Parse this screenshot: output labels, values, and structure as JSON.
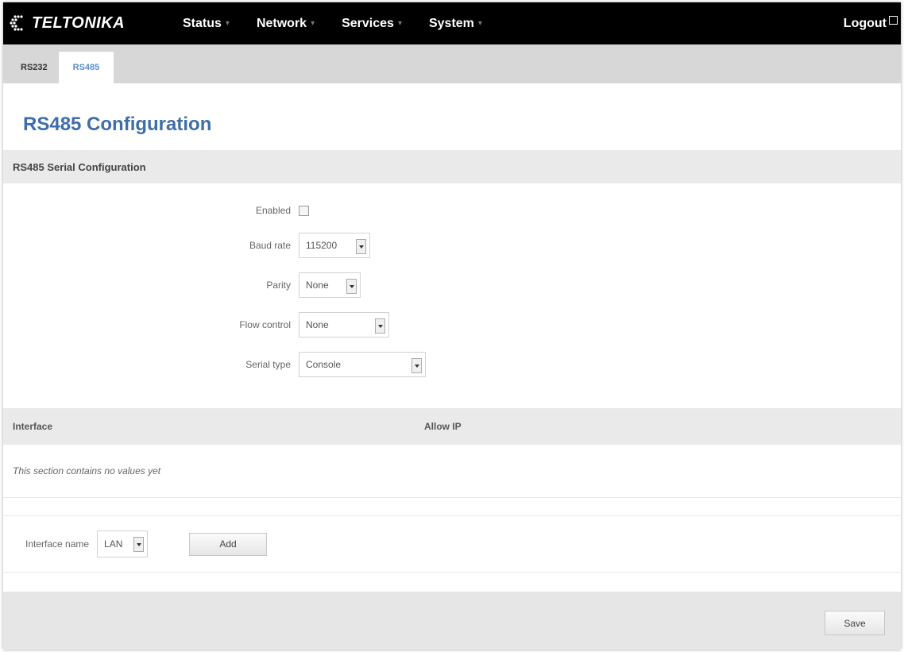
{
  "header": {
    "logo_text": "TELTONIKA",
    "nav": [
      {
        "label": "Status"
      },
      {
        "label": "Network"
      },
      {
        "label": "Services"
      },
      {
        "label": "System"
      }
    ],
    "logout_label": "Logout"
  },
  "tabs": [
    {
      "label": "RS232",
      "active": false
    },
    {
      "label": "RS485",
      "active": true
    }
  ],
  "page_title": "RS485 Configuration",
  "section_title": "RS485 Serial Configuration",
  "form": {
    "enabled_label": "Enabled",
    "enabled_checked": false,
    "baud_rate_label": "Baud rate",
    "baud_rate_value": "115200",
    "parity_label": "Parity",
    "parity_value": "None",
    "flow_control_label": "Flow control",
    "flow_control_value": "None",
    "serial_type_label": "Serial type",
    "serial_type_value": "Console"
  },
  "table": {
    "col_interface": "Interface",
    "col_allow_ip": "Allow IP",
    "empty_text": "This section contains no values yet"
  },
  "add_section": {
    "interface_name_label": "Interface name",
    "interface_name_value": "LAN",
    "add_button": "Add"
  },
  "save_button": "Save",
  "colors": {
    "topbar": "#000000",
    "accent_blue": "#3e6ea9",
    "tab_active_text": "#5a8fd0"
  }
}
